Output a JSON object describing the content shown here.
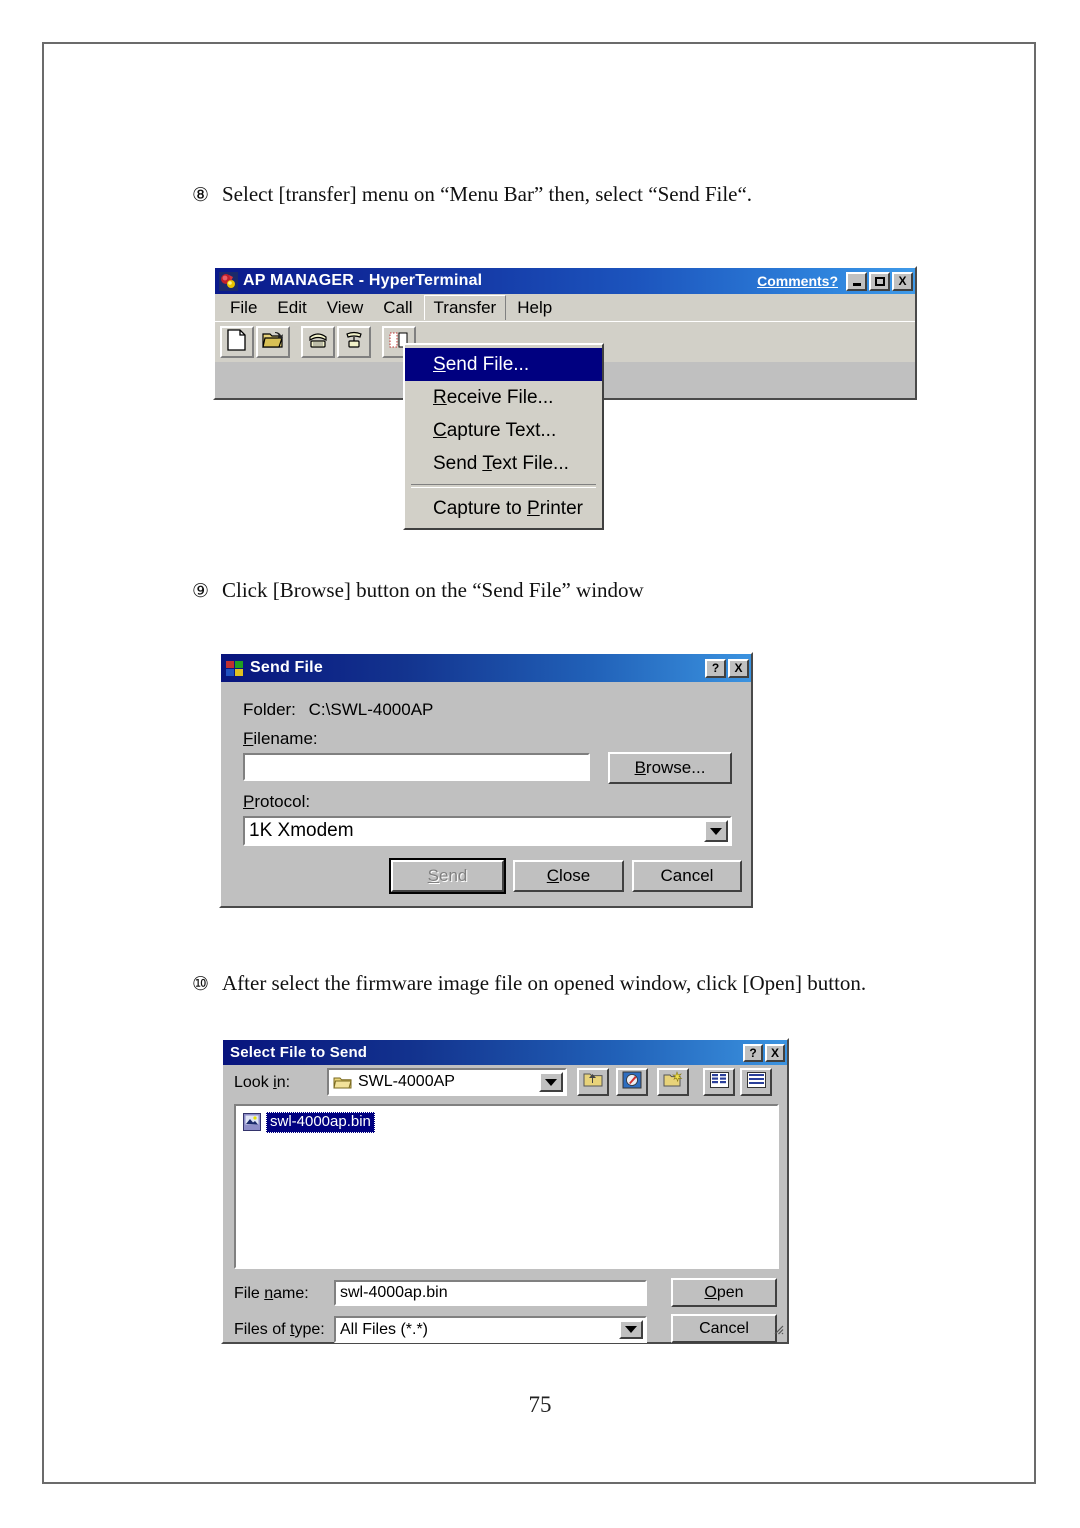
{
  "page": {
    "number": "75"
  },
  "instructions": [
    {
      "marker": "⑧",
      "text": "Select [transfer] menu on “Menu Bar” then, select “Send File“."
    },
    {
      "marker": "⑨",
      "text": "Click [Browse] button on the “Send File” window"
    },
    {
      "marker": "⑩",
      "text": "After select the firmware image file on opened window, click [Open] button."
    }
  ],
  "hyperterminal": {
    "title": "AP MANAGER - HyperTerminal",
    "comments_link": "Comments?",
    "window_buttons": {
      "minimize": "minimize-icon",
      "maximize": "maximize-icon",
      "close": "X"
    },
    "menus": [
      {
        "label": "File",
        "open": false
      },
      {
        "label": "Edit",
        "open": false
      },
      {
        "label": "View",
        "open": false
      },
      {
        "label": "Call",
        "open": false
      },
      {
        "label": "Transfer",
        "open": true
      },
      {
        "label": "Help",
        "open": false
      }
    ],
    "toolbar_icons": [
      "new-document-icon",
      "open-folder-icon",
      "call-phone-icon",
      "disconnect-phone-icon",
      "properties-icon"
    ],
    "transfer_menu": {
      "items": [
        {
          "label": "Send File...",
          "accel": "S",
          "selected": true,
          "separator_after": false
        },
        {
          "label": "Receive File...",
          "accel": "R",
          "selected": false,
          "separator_after": false
        },
        {
          "label": "Capture Text...",
          "accel": "C",
          "selected": false,
          "separator_after": false
        },
        {
          "label": "Send Text File...",
          "accel": "T",
          "selected": false,
          "separator_after": true
        },
        {
          "label": "Capture to Printer",
          "accel": "P",
          "selected": false,
          "separator_after": false
        }
      ]
    }
  },
  "send_file_dialog": {
    "title": "Send File",
    "icon": "send-file-icon",
    "help_button": "?",
    "close_button": "X",
    "folder_label": "Folder:",
    "folder_value": "C:\\SWL-4000AP",
    "filename_label": "Filename:",
    "filename_value": "",
    "browse_button": "Browse...",
    "protocol_label": "Protocol:",
    "protocol_value": "1K Xmodem",
    "buttons": {
      "send": "Send",
      "send_disabled": true,
      "close": "Close",
      "cancel": "Cancel"
    }
  },
  "select_file_dialog": {
    "title": "Select File to Send",
    "help_button": "?",
    "close_button": "X",
    "look_in_label": "Look in:",
    "look_in_value": "SWL-4000AP",
    "toolbar_icons": [
      "up-one-level-icon",
      "desktop-icon",
      "new-folder-icon",
      "list-view-icon",
      "details-view-icon"
    ],
    "files": [
      {
        "name": "swl-4000ap.bin",
        "icon": "binary-file-icon",
        "selected": true
      }
    ],
    "file_name_label": "File name:",
    "file_name_value": "swl-4000ap.bin",
    "files_of_type_label": "Files of type:",
    "files_of_type_value": "All Files (*.*)",
    "open_button": "Open",
    "cancel_button": "Cancel"
  },
  "colors": {
    "title_gradient_start": "#0a1a8c",
    "title_gradient_end": "#3f9ae8",
    "menu_highlight": "#000080",
    "dialog_face": "#c0c0c0",
    "menu_face": "#d2d0c8"
  }
}
